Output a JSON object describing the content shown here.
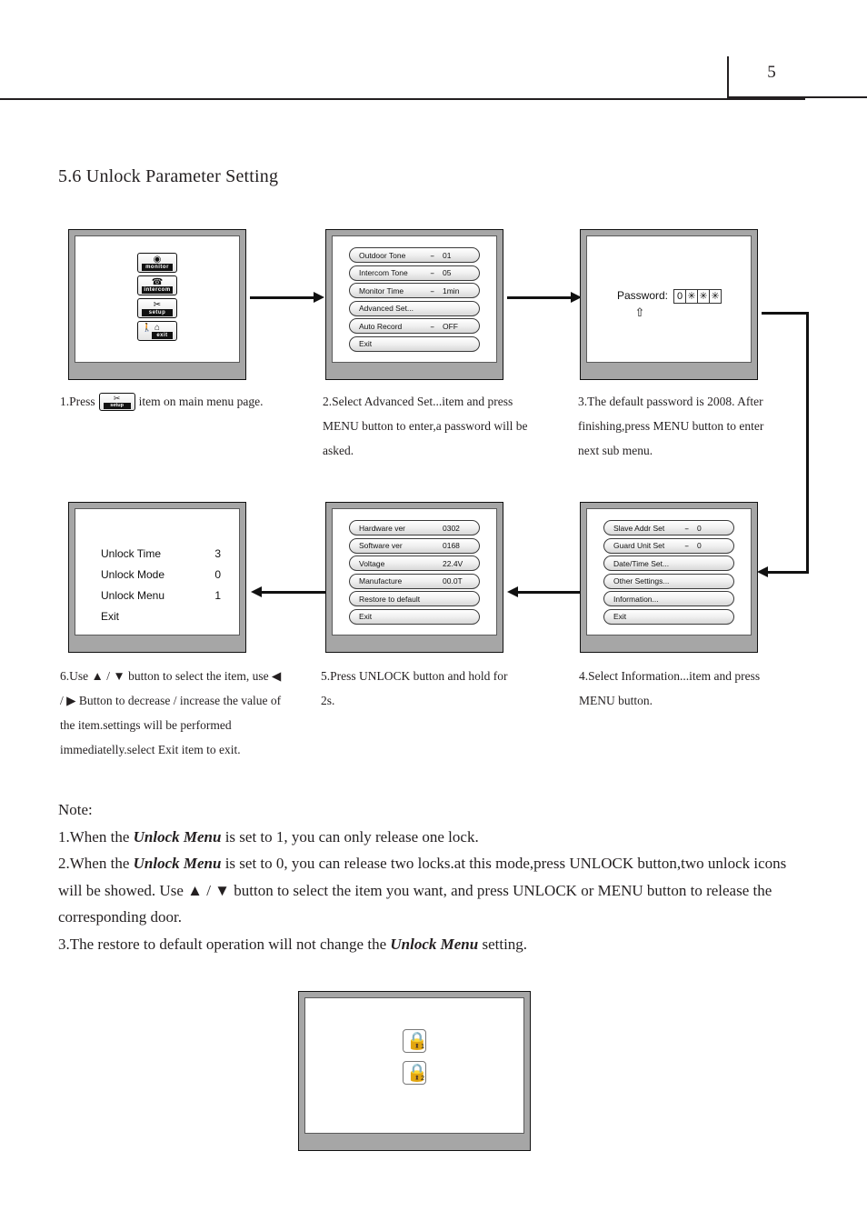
{
  "header": {
    "page_number": "5"
  },
  "section": {
    "title": "5.6 Unlock Parameter Setting"
  },
  "screens": {
    "main_menu": {
      "items": [
        {
          "glyph": "◉",
          "caption": "monitor",
          "name": "monitor"
        },
        {
          "glyph": "☎",
          "caption": "intercom",
          "name": "intercom"
        },
        {
          "glyph": "✂",
          "caption": "setup",
          "name": "setup"
        },
        {
          "glyph": "⌂",
          "caption": "exit",
          "name": "exit"
        }
      ]
    },
    "setup_menu": {
      "rows": [
        {
          "label": "Outdoor Tone",
          "dash": "--",
          "value": "01"
        },
        {
          "label": "Intercom Tone",
          "dash": "--",
          "value": "05"
        },
        {
          "label": "Monitor Time",
          "dash": "--",
          "value": "1min"
        },
        {
          "label": "Advanced Set...",
          "dash": "",
          "value": ""
        },
        {
          "label": "Auto Record",
          "dash": "--",
          "value": "OFF"
        },
        {
          "label": "Exit",
          "dash": "",
          "value": ""
        }
      ]
    },
    "password": {
      "label": "Password:",
      "digits": [
        "0",
        "✳",
        "✳",
        "✳"
      ],
      "caret": "⇧"
    },
    "advanced_menu": {
      "rows": [
        {
          "label": "Slave Addr Set",
          "dash": "--",
          "value": "0"
        },
        {
          "label": "Guard Unit Set",
          "dash": "--",
          "value": "0"
        },
        {
          "label": "Date/Time Set...",
          "dash": "",
          "value": ""
        },
        {
          "label": "Other Settings...",
          "dash": "",
          "value": ""
        },
        {
          "label": "Information...",
          "dash": "",
          "value": ""
        },
        {
          "label": "Exit",
          "dash": "",
          "value": ""
        }
      ]
    },
    "information_menu": {
      "rows": [
        {
          "label": "Hardware ver",
          "dash": "",
          "value": "0302"
        },
        {
          "label": "Software ver",
          "dash": "",
          "value": "0168"
        },
        {
          "label": "Voltage",
          "dash": "",
          "value": "22.4V"
        },
        {
          "label": "Manufacture",
          "dash": "",
          "value": "00.0T"
        },
        {
          "label": "Restore to default",
          "dash": "",
          "value": ""
        },
        {
          "label": "Exit",
          "dash": "",
          "value": ""
        }
      ]
    },
    "unlock_settings": {
      "rows": [
        {
          "label": "Unlock Time",
          "value": "3"
        },
        {
          "label": "Unlock Mode",
          "value": "0"
        },
        {
          "label": "Unlock Menu",
          "value": "1"
        },
        {
          "label": "Exit",
          "value": ""
        }
      ]
    },
    "lock_select": {
      "locks": [
        {
          "glyph": "🔒",
          "number": "1"
        },
        {
          "glyph": "🔒",
          "number": "2"
        }
      ]
    }
  },
  "captions": {
    "step1_a": "1.Press",
    "step1_b": "item on main",
    "step1_c": "menu page.",
    "step1_icon_caption": "setup",
    "step1_icon_glyph": "✂",
    "step2": "2.Select Advanced Set...item and press MENU button to enter,a password will be asked.",
    "step3": "3.The default password is 2008. After finishing,press MENU button to enter next sub menu.",
    "step4": "4.Select Information...item and press MENU button.",
    "step5": "5.Press UNLOCK button and hold for 2s.",
    "step6": "6.Use ▲ / ▼ button to select the item, use ◀ / ▶ Button to decrease / increase the value of the item.settings will be performed immediatelly.select Exit item to exit."
  },
  "note": {
    "title": "Note:",
    "line1_pre": "1.When the ",
    "line1_em": "Unlock Menu",
    "line1_post": " is set to 1, you can only release one lock.",
    "line2_pre": "2.When the  ",
    "line2_em": "Unlock Menu",
    "line2_post": " is set to 0, you can release two locks.at this mode,press UNLOCK button,two unlock icons will be showed. Use ▲ / ▼ button to select the item you want, and press UNLOCK or MENU button to release the corresponding door.",
    "line3_pre": "3.The restore to default operation will not change the ",
    "line3_em": "Unlock Menu",
    "line3_post": " setting."
  }
}
